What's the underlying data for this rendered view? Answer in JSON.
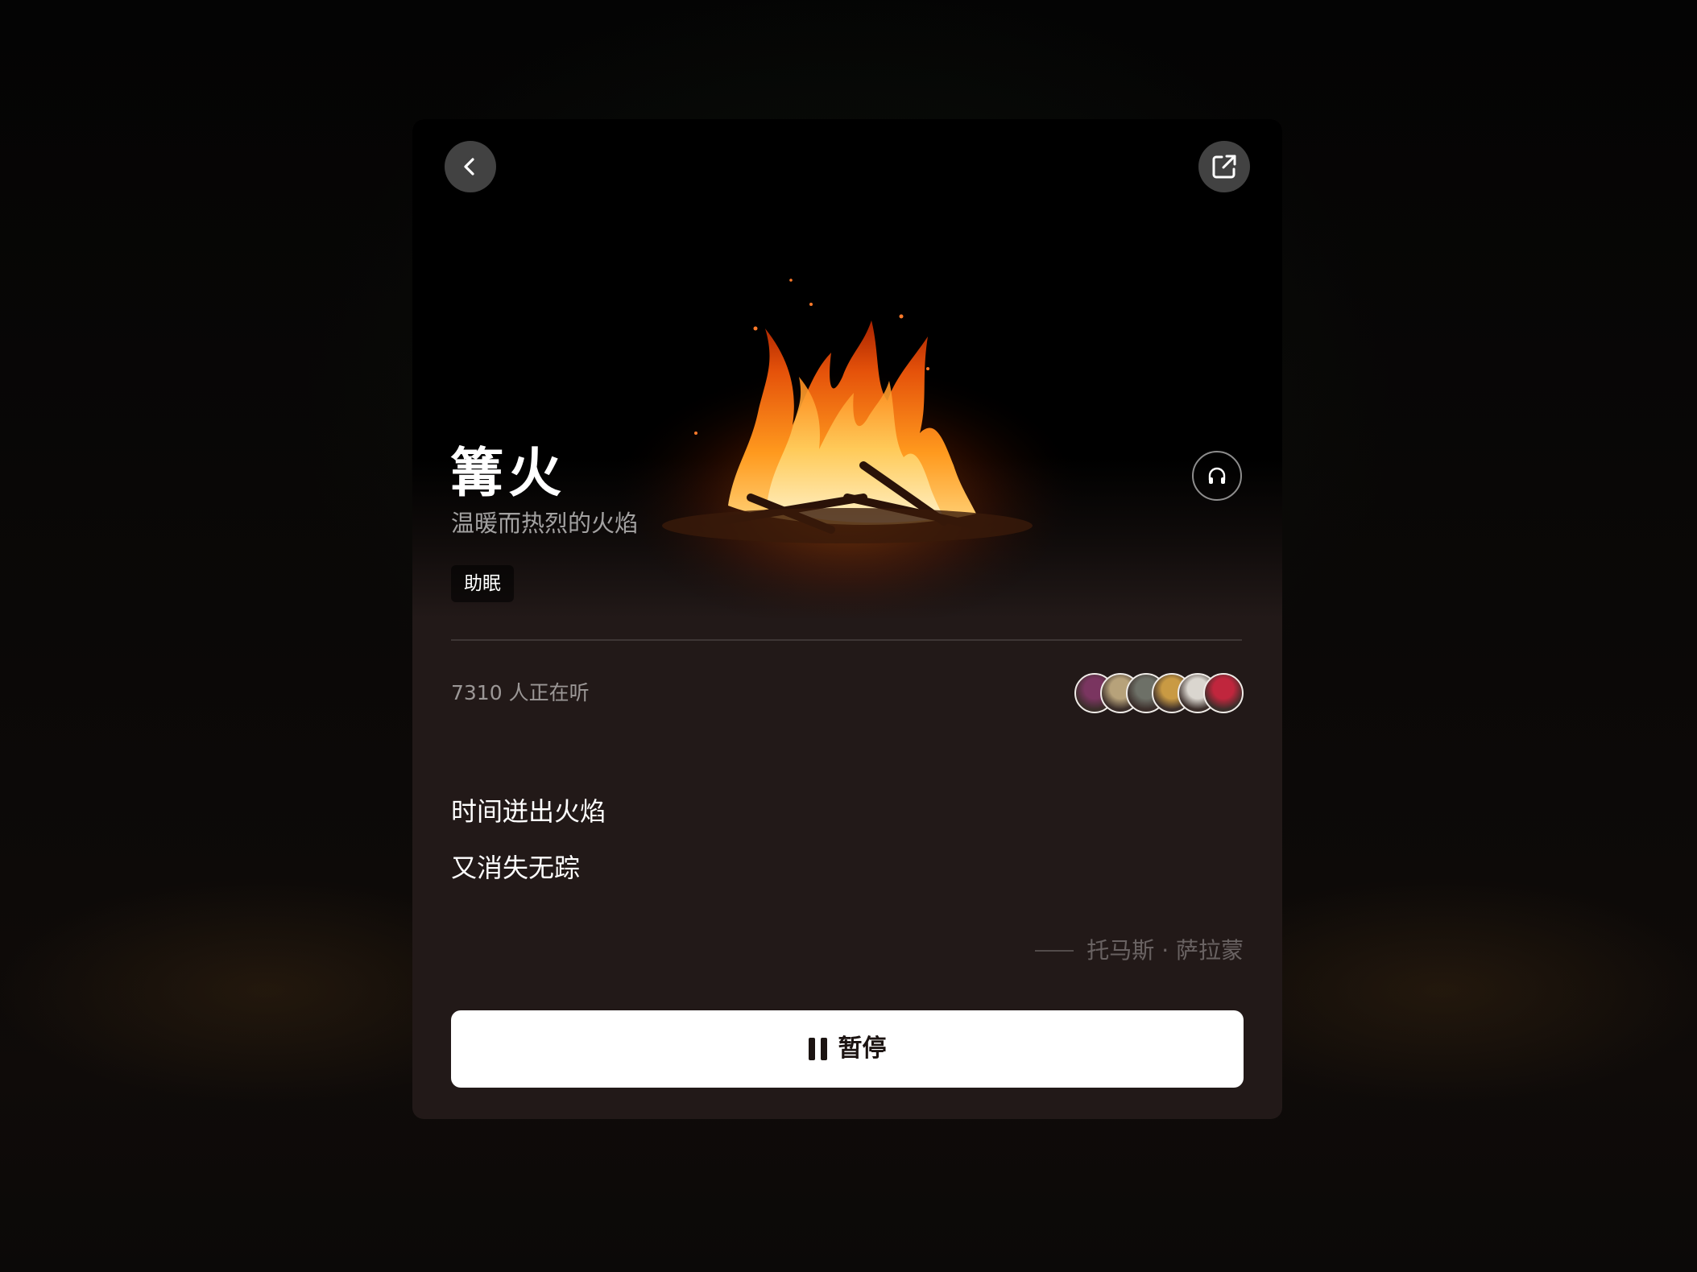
{
  "sound": {
    "title": "篝火",
    "subtitle": "温暖而热烈的火焰",
    "tag": "助眠",
    "listeners_text": "7310 人正在听",
    "avatar_colors": [
      "#7a3560",
      "#b7a27a",
      "#6d7067",
      "#c99a43",
      "#dad6cf",
      "#c0263d"
    ]
  },
  "quote": {
    "line1": "时间迸出火焰",
    "line2": "又消失无踪",
    "author": "托马斯 · 萨拉蒙"
  },
  "controls": {
    "pause_label": "暂停"
  },
  "icons": {
    "back": "chevron-left-icon",
    "share": "share-external-icon",
    "listen": "headphones-icon",
    "pause": "pause-icon"
  }
}
